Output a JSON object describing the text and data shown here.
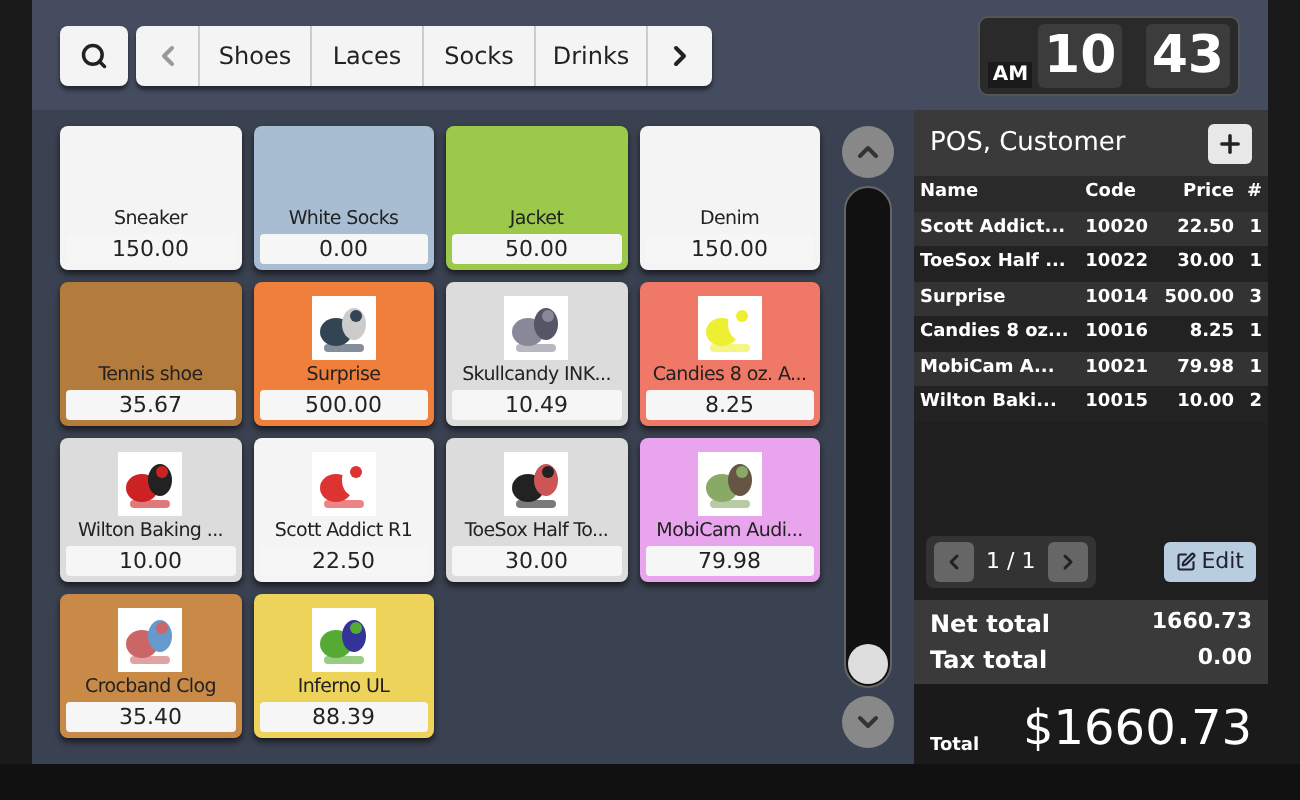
{
  "toolbar": {
    "categories": [
      {
        "label": "Shoes"
      },
      {
        "label": "Laces"
      },
      {
        "label": "Socks"
      },
      {
        "label": "Drinks"
      }
    ]
  },
  "clock": {
    "period": "AM",
    "hours": "10",
    "minutes": "43"
  },
  "tiles": [
    {
      "name": "Sneaker",
      "price": "150.00",
      "color": "#f4f4f4",
      "kind": "plain"
    },
    {
      "name": "White Socks",
      "price": "0.00",
      "color": "#a9bdd2",
      "kind": "plain"
    },
    {
      "name": "Jacket",
      "price": "50.00",
      "color": "#9cc94a",
      "kind": "plain"
    },
    {
      "name": "Denim",
      "price": "150.00",
      "color": "#f4f4f4",
      "kind": "plain"
    },
    {
      "name": "Tennis shoe",
      "price": "35.67",
      "color": "#b47c3c",
      "kind": "plain"
    },
    {
      "name": "Surprise",
      "price": "500.00",
      "color": "#ef7f3a",
      "kind": "picture"
    },
    {
      "name": "Skullcandy INK...",
      "price": "10.49",
      "color": "#dcdcdc",
      "kind": "picture"
    },
    {
      "name": "Candies 8 oz. A...",
      "price": "8.25",
      "color": "#ef7866",
      "kind": "picture"
    },
    {
      "name": "Wilton Baking ...",
      "price": "10.00",
      "color": "#dcdcdc",
      "kind": "picture"
    },
    {
      "name": "Scott Addict R1",
      "price": "22.50",
      "color": "#f4f4f4",
      "kind": "picture"
    },
    {
      "name": "ToeSox Half To...",
      "price": "30.00",
      "color": "#dcdcdc",
      "kind": "picture"
    },
    {
      "name": "MobiCam Audi...",
      "price": "79.98",
      "color": "#e9a4ee",
      "kind": "picture"
    },
    {
      "name": "Crocband Clog",
      "price": "35.40",
      "color": "#c98a48",
      "kind": "picture"
    },
    {
      "name": "Inferno UL",
      "price": "88.39",
      "color": "#eed35a",
      "kind": "picture"
    }
  ],
  "order": {
    "title": "POS, Customer",
    "columns": [
      "Name",
      "Code",
      "Price",
      "#"
    ],
    "rows": [
      [
        "Scott Addict...",
        "10020",
        "22.50",
        "1"
      ],
      [
        "ToeSox Half ...",
        "10022",
        "30.00",
        "1"
      ],
      [
        "Surprise",
        "10014",
        "500.00",
        "3"
      ],
      [
        "Candies 8 oz...",
        "10016",
        "8.25",
        "1"
      ],
      [
        "MobiCam A...",
        "10021",
        "79.98",
        "1"
      ],
      [
        "Wilton Baki...",
        "10015",
        "10.00",
        "2"
      ]
    ],
    "page": "1 / 1",
    "edit": "Edit",
    "net_total_label": "Net total",
    "net_total": "1660.73",
    "tax_total_label": "Tax total",
    "tax_total": "0.00",
    "total_label": "Total",
    "total": "$1660.73"
  }
}
